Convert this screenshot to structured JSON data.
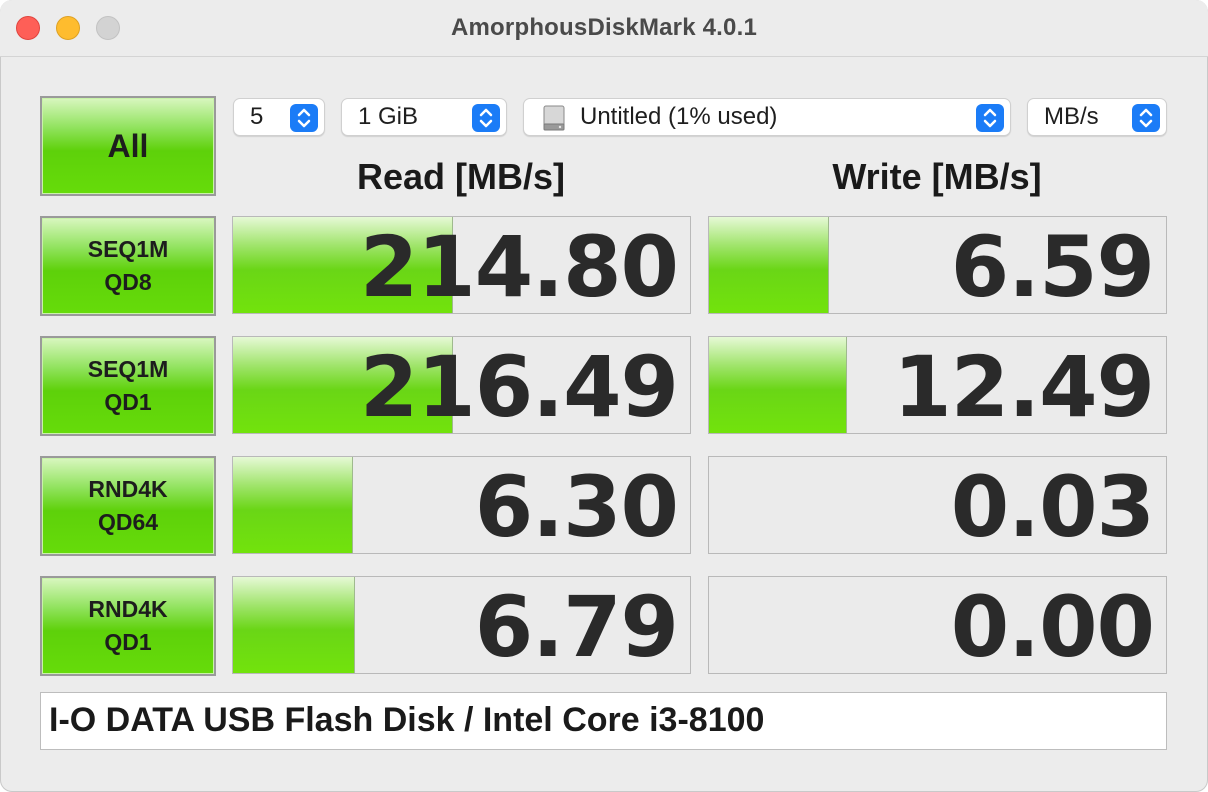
{
  "window": {
    "title": "AmorphousDiskMark 4.0.1"
  },
  "controls": {
    "all_label": "All",
    "count_value": "5",
    "size_value": "1 GiB",
    "drive_value": "Untitled (1% used)",
    "unit_value": "MB/s"
  },
  "headers": {
    "read": "Read [MB/s]",
    "write": "Write [MB/s]"
  },
  "tests": [
    {
      "line1": "SEQ1M",
      "line2": "QD8",
      "read": "214.80",
      "write": "6.59",
      "read_bar_fraction": 0.48,
      "write_bar_fraction": 0.26
    },
    {
      "line1": "SEQ1M",
      "line2": "QD1",
      "read": "216.49",
      "write": "12.49",
      "read_bar_fraction": 0.48,
      "write_bar_fraction": 0.3
    },
    {
      "line1": "RND4K",
      "line2": "QD64",
      "read": "6.30",
      "write": "0.03",
      "read_bar_fraction": 0.26,
      "write_bar_fraction": 0.0
    },
    {
      "line1": "RND4K",
      "line2": "QD1",
      "read": "6.79",
      "write": "0.00",
      "read_bar_fraction": 0.265,
      "write_bar_fraction": 0.0
    }
  ],
  "comment": "I-O DATA USB Flash Disk / Intel Core i3-8100",
  "icons": {
    "select_arrows": "updown-chevron-icon",
    "drive": "disk-icon"
  },
  "colors": {
    "accent": "#1b7cf7",
    "bar_green": "#6ad616"
  }
}
